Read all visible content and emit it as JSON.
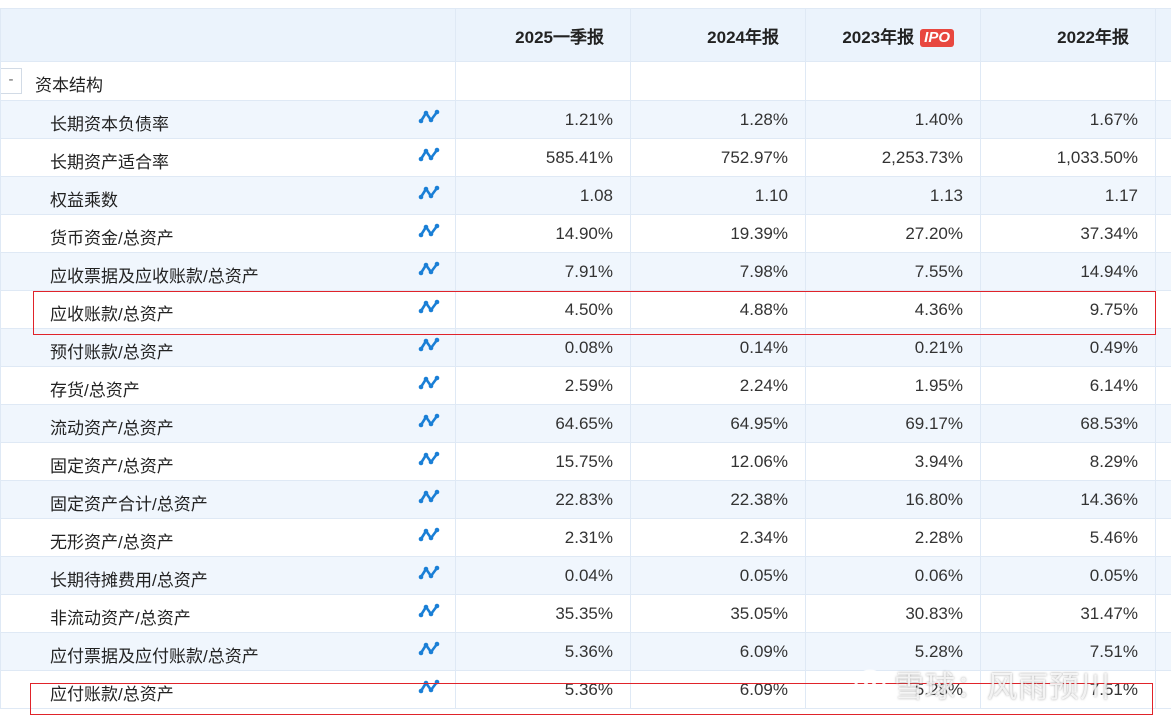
{
  "header": {
    "columns": [
      "2025一季报",
      "2024年报",
      "2023年报",
      "2022年报"
    ],
    "ipo_badge": "IPO"
  },
  "section": {
    "toggle": "-",
    "label": "资本结构"
  },
  "rows": [
    {
      "label": "长期资本负债率",
      "values": [
        "1.21%",
        "1.28%",
        "1.40%",
        "1.67%"
      ]
    },
    {
      "label": "长期资产适合率",
      "values": [
        "585.41%",
        "752.97%",
        "2,253.73%",
        "1,033.50%"
      ]
    },
    {
      "label": "权益乘数",
      "values": [
        "1.08",
        "1.10",
        "1.13",
        "1.17"
      ]
    },
    {
      "label": "货币资金/总资产",
      "values": [
        "14.90%",
        "19.39%",
        "27.20%",
        "37.34%"
      ]
    },
    {
      "label": "应收票据及应收账款/总资产",
      "values": [
        "7.91%",
        "7.98%",
        "7.55%",
        "14.94%"
      ]
    },
    {
      "label": "应收账款/总资产",
      "values": [
        "4.50%",
        "4.88%",
        "4.36%",
        "9.75%"
      ]
    },
    {
      "label": "预付账款/总资产",
      "values": [
        "0.08%",
        "0.14%",
        "0.21%",
        "0.49%"
      ]
    },
    {
      "label": "存货/总资产",
      "values": [
        "2.59%",
        "2.24%",
        "1.95%",
        "6.14%"
      ]
    },
    {
      "label": "流动资产/总资产",
      "values": [
        "64.65%",
        "64.95%",
        "69.17%",
        "68.53%"
      ]
    },
    {
      "label": "固定资产/总资产",
      "values": [
        "15.75%",
        "12.06%",
        "3.94%",
        "8.29%"
      ]
    },
    {
      "label": "固定资产合计/总资产",
      "values": [
        "22.83%",
        "22.38%",
        "16.80%",
        "14.36%"
      ]
    },
    {
      "label": "无形资产/总资产",
      "values": [
        "2.31%",
        "2.34%",
        "2.28%",
        "5.46%"
      ]
    },
    {
      "label": "长期待摊费用/总资产",
      "values": [
        "0.04%",
        "0.05%",
        "0.06%",
        "0.05%"
      ]
    },
    {
      "label": "非流动资产/总资产",
      "values": [
        "35.35%",
        "35.05%",
        "30.83%",
        "31.47%"
      ]
    },
    {
      "label": "应付票据及应付账款/总资产",
      "values": [
        "5.36%",
        "6.09%",
        "5.28%",
        "7.51%"
      ]
    },
    {
      "label": "应付账款/总资产",
      "values": [
        "5.36%",
        "6.09%",
        "5.28%",
        "7.51%"
      ]
    }
  ],
  "icons": {
    "trend": "trend-chart-icon",
    "watermark_logo": "snowball-logo-icon"
  },
  "colors": {
    "header_bg": "#ebf3fc",
    "alt_row_bg": "#f0f6fd",
    "border": "#dfe9f5",
    "trend_icon": "#1a7fd6",
    "highlight": "#e0232a",
    "ipo_badge": "#e8473f"
  },
  "watermark": {
    "text": "雪球：风雨预川"
  }
}
